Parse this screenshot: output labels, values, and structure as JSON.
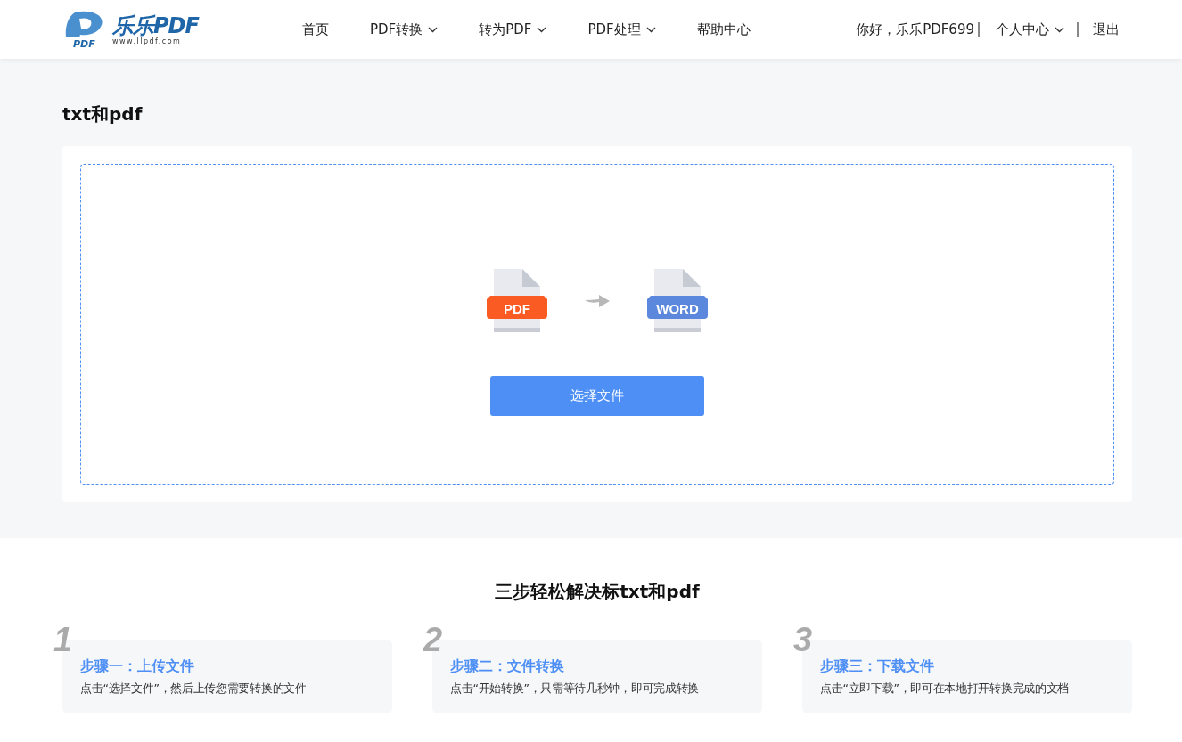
{
  "logo": {
    "badge": "PDF",
    "name": "乐乐PDF",
    "url": "www.llpdf.com"
  },
  "nav": [
    {
      "label": "首页",
      "dropdown": false
    },
    {
      "label": "PDF转换",
      "dropdown": true
    },
    {
      "label": "转为PDF",
      "dropdown": true
    },
    {
      "label": "PDF处理",
      "dropdown": true
    },
    {
      "label": "帮助中心",
      "dropdown": false
    }
  ],
  "user": {
    "greeting": "你好，乐乐PDF699",
    "menu": "个人中心",
    "logout": "退出"
  },
  "page_title": "txt和pdf",
  "upload": {
    "from_label": "PDF",
    "to_label": "WORD",
    "button": "选择文件"
  },
  "steps_heading": "三步轻松解决标txt和pdf",
  "steps": [
    {
      "number": "1",
      "title": "步骤一：上传文件",
      "text": "点击“选择文件”，然后上传您需要转换的文件"
    },
    {
      "number": "2",
      "title": "步骤二：文件转换",
      "text": "点击“开始转换”，只需等待几秒钟，即可完成转换"
    },
    {
      "number": "3",
      "title": "步骤三：下载文件",
      "text": "点击“立即下载”，即可在本地打开转换完成的文档"
    }
  ]
}
